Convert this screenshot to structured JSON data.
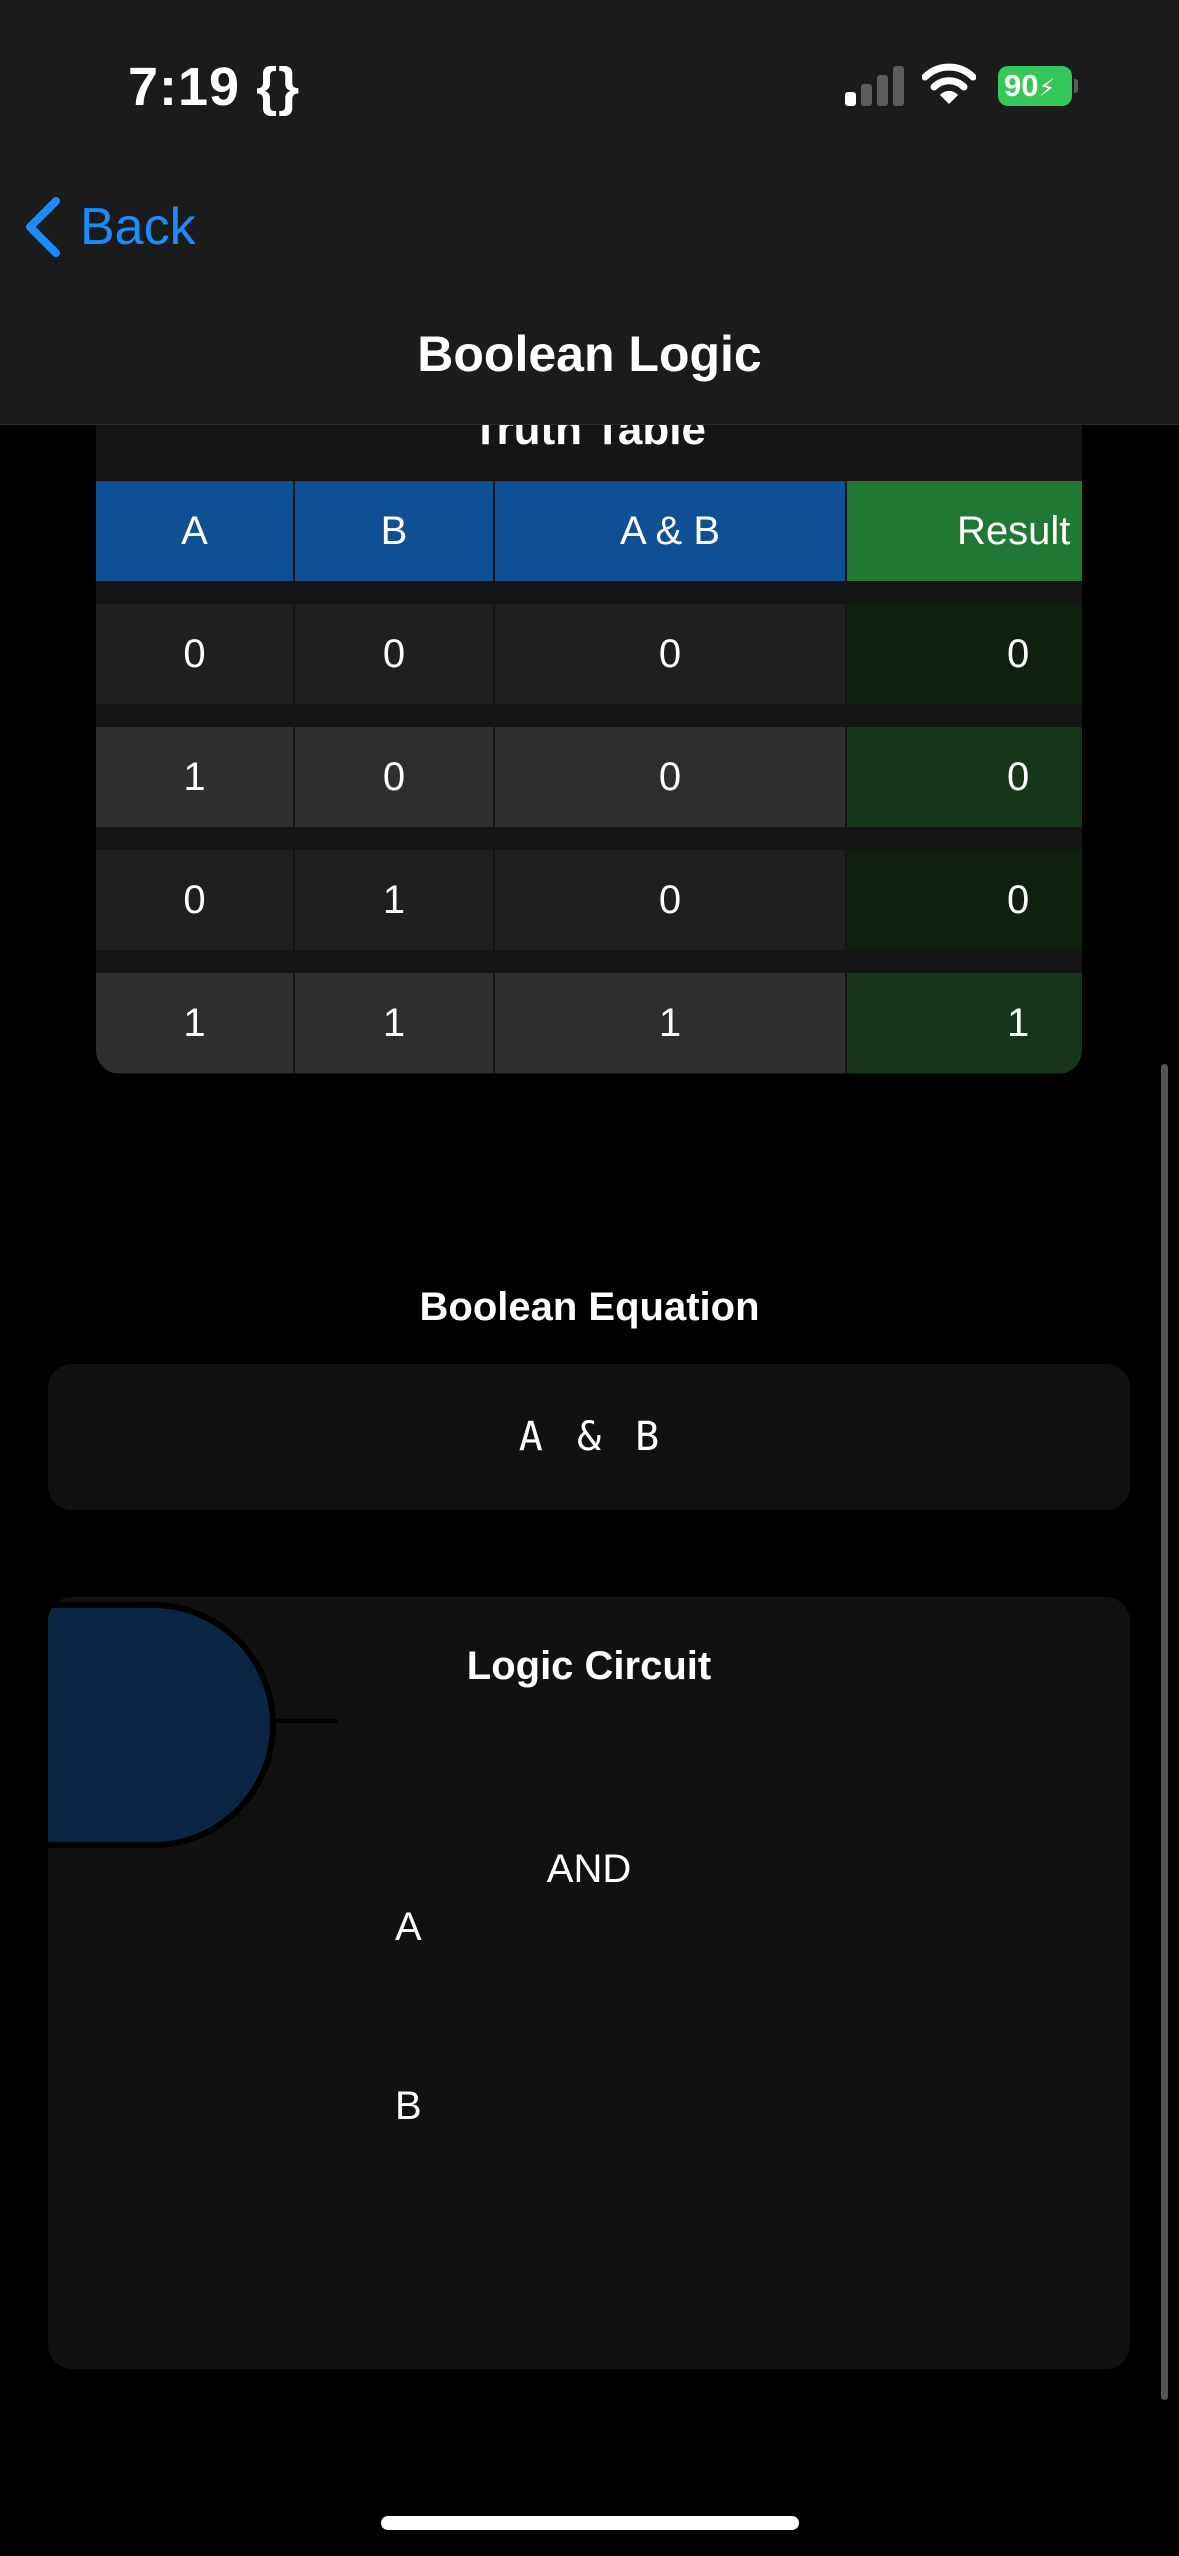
{
  "status_bar": {
    "time": "7:19 {}",
    "battery": "90",
    "icons": [
      "cellular-signal-icon",
      "wifi-icon",
      "battery-charging-icon"
    ]
  },
  "nav": {
    "back_label": "Back",
    "title": "Boolean Logic"
  },
  "truth_table": {
    "title": "Truth Table",
    "headers": [
      "A",
      "B",
      "A & B",
      "Result"
    ],
    "rows": [
      [
        "0",
        "0",
        "0",
        "0"
      ],
      [
        "1",
        "0",
        "0",
        "0"
      ],
      [
        "0",
        "1",
        "0",
        "0"
      ],
      [
        "1",
        "1",
        "1",
        "1"
      ]
    ]
  },
  "equation": {
    "title": "Boolean Equation",
    "value": "A & B"
  },
  "circuit": {
    "title": "Logic Circuit",
    "gate_label": "AND",
    "input_a": "A",
    "input_b": "B"
  },
  "colors": {
    "accent": "#1a8cff",
    "header_blue": "#0f4f93",
    "result_green": "#217835",
    "gate_fill": "#0c2542"
  }
}
